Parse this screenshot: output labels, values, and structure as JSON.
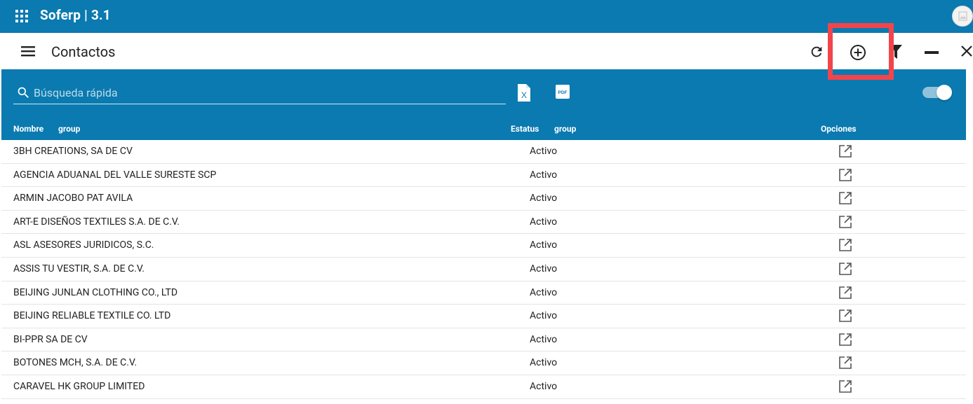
{
  "app": {
    "title": "Soferp | 3.1",
    "accent_color": "#0a7ab0"
  },
  "toolbar": {
    "title": "Contactos",
    "icons": [
      "menu-icon",
      "refresh-icon",
      "add-circle-icon",
      "filter-icon",
      "minimize-icon",
      "close-icon"
    ],
    "highlight_color": "#f2454b"
  },
  "search": {
    "placeholder": "Búsqueda rápida",
    "value": ""
  },
  "export": {
    "excel_icon_label": "X",
    "pdf_icon_label": "PDF"
  },
  "toggle": {
    "on": true
  },
  "table": {
    "headers": {
      "nombre": "Nombre",
      "group1": "group",
      "estatus": "Estatus",
      "group2": "group",
      "opciones": "Opciones"
    },
    "rows": [
      {
        "name": "3BH CREATIONS, SA DE CV",
        "status": "Activo"
      },
      {
        "name": "AGENCIA ADUANAL DEL VALLE SURESTE SCP",
        "status": "Activo"
      },
      {
        "name": "ARMIN JACOBO PAT AVILA",
        "status": "Activo"
      },
      {
        "name": "ART-E DISEÑOS TEXTILES S.A. DE C.V.",
        "status": "Activo"
      },
      {
        "name": "ASL ASESORES JURIDICOS, S.C.",
        "status": "Activo"
      },
      {
        "name": "ASSIS TU VESTIR, S.A. DE C.V.",
        "status": "Activo"
      },
      {
        "name": "BEIJING JUNLAN CLOTHING CO., LTD",
        "status": "Activo"
      },
      {
        "name": "BEIJING RELIABLE TEXTILE CO. LTD",
        "status": "Activo"
      },
      {
        "name": "BI-PPR SA DE CV",
        "status": "Activo"
      },
      {
        "name": "BOTONES MCH, S.A. DE C.V.",
        "status": "Activo"
      },
      {
        "name": "CARAVEL HK GROUP LIMITED",
        "status": "Activo"
      }
    ]
  }
}
